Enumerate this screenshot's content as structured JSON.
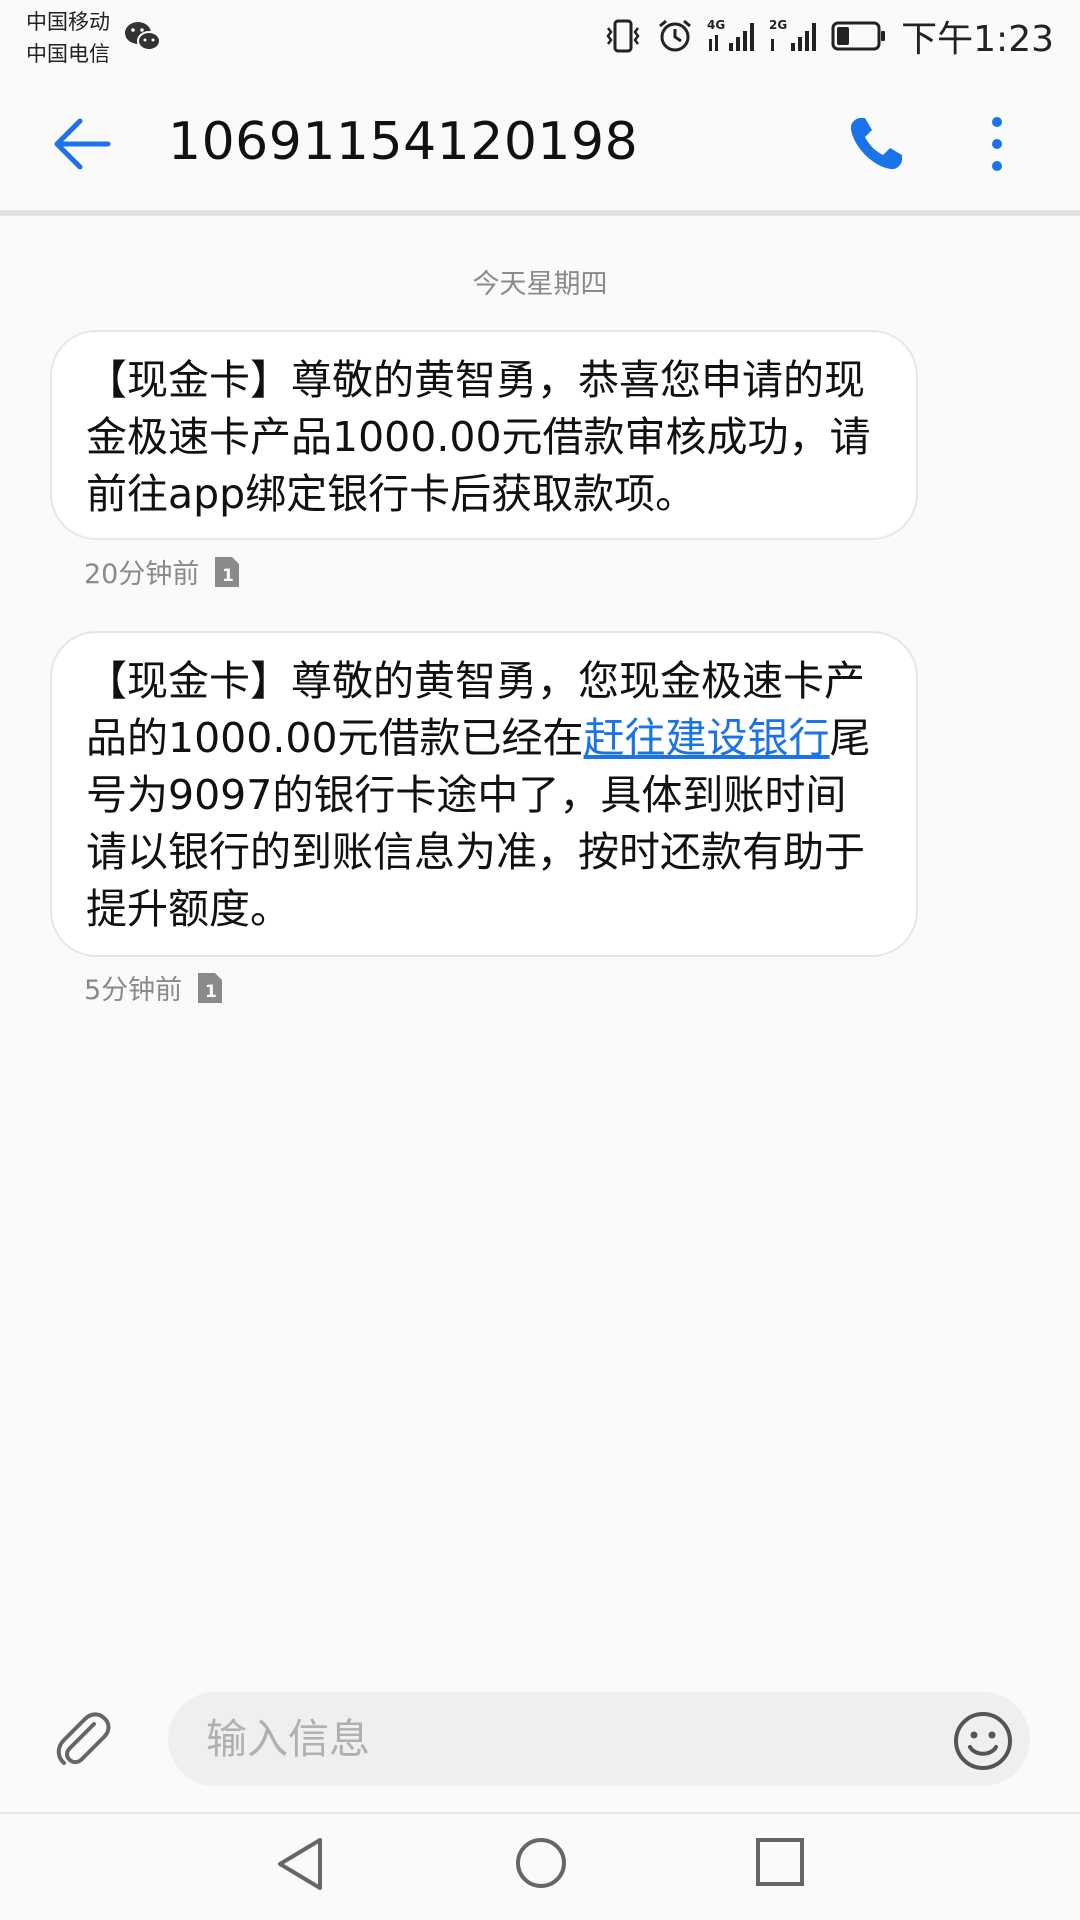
{
  "status_bar": {
    "carrier_1": "中国移动",
    "carrier_2": "中国电信",
    "network_1": "4G",
    "network_2": "2G",
    "time": "下午1:23",
    "icons": [
      "wechat-icon",
      "vibrate-icon",
      "alarm-icon",
      "signal-4g-icon",
      "signal-2g-icon",
      "battery-icon"
    ]
  },
  "app_bar": {
    "title": "10691154120198",
    "icons": [
      "back-arrow-icon",
      "phone-icon",
      "more-vert-icon"
    ]
  },
  "conversation": {
    "date_separator": "今天星期四",
    "messages": [
      {
        "text": "【现金卡】尊敬的黄智勇，恭喜您申请的现金极速卡产品1000.00元借款审核成功，请前往app绑定银行卡后获取款项。",
        "time": "20分钟前",
        "sim": "1"
      },
      {
        "text_before_link": "【现金卡】尊敬的黄智勇，您现金极速卡产品的1000.00元借款已经在",
        "link": "赶往建设银行",
        "text_after_link": "尾号为9097的银行卡途中了，具体到账时间请以银行的到账信息为准，按时还款有助于提升额度。",
        "time": "5分钟前",
        "sim": "1"
      }
    ]
  },
  "composer": {
    "placeholder": "输入信息",
    "icons": [
      "attach-icon",
      "emoji-icon"
    ]
  },
  "nav_bar": {
    "icons": [
      "nav-back-icon",
      "nav-home-icon",
      "nav-recents-icon"
    ]
  },
  "colors": {
    "accent": "#1a73e8",
    "background": "#fafafa",
    "bubble": "#ffffff",
    "secondary_text": "#8a8a8a"
  }
}
